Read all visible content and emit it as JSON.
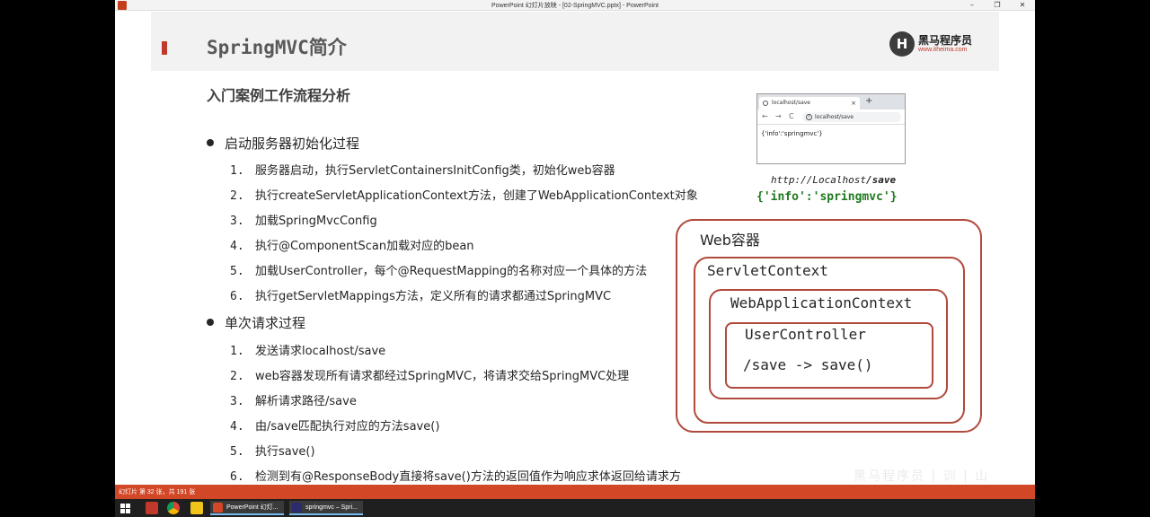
{
  "window": {
    "title": "PowerPoint 幻灯片放映 - [02-SpringMVC.pptx] - PowerPoint",
    "controls": {
      "minimize": "–",
      "restore": "❐",
      "close": "✕"
    }
  },
  "slide": {
    "title": "SpringMVC简介",
    "logo": {
      "mark": "H",
      "name": "黑马程序员",
      "url": "www.itheima.com"
    },
    "subtitle": "入门案例工作流程分析",
    "sections": [
      {
        "heading": "启动服务器初始化过程",
        "steps": [
          {
            "num": "1.",
            "text": "服务器启动，执行ServletContainersInitConfig类，初始化web容器"
          },
          {
            "num": "2.",
            "text": "执行createServletApplicationContext方法，创建了WebApplicationContext对象"
          },
          {
            "num": "3.",
            "text": "加载SpringMvcConfig"
          },
          {
            "num": "4.",
            "text": "执行@ComponentScan加载对应的bean"
          },
          {
            "num": "5.",
            "text": "加载UserController，每个@RequestMapping的名称对应一个具体的方法"
          },
          {
            "num": "6.",
            "text": "执行getServletMappings方法，定义所有的请求都通过SpringMVC"
          }
        ]
      },
      {
        "heading": "单次请求过程",
        "steps": [
          {
            "num": "1.",
            "text": "发送请求localhost/save"
          },
          {
            "num": "2.",
            "text": "web容器发现所有请求都经过SpringMVC，将请求交给SpringMVC处理"
          },
          {
            "num": "3.",
            "text": "解析请求路径/save"
          },
          {
            "num": "4.",
            "text": "由/save匹配执行对应的方法save()"
          },
          {
            "num": "5.",
            "text": "执行save()"
          },
          {
            "num": "6.",
            "text": "检测到有@ResponseBody直接将save()方法的返回值作为响应求体返回给请求方"
          }
        ]
      }
    ],
    "browser": {
      "tab_title": "localhost/save",
      "tab_close": "×",
      "new_tab": "+",
      "back": "←",
      "forward": "→",
      "reload": "C",
      "address": "localhost/save",
      "body": "{'info':'springmvc'}"
    },
    "url_caption": {
      "prefix": "http://",
      "host": "Localhost",
      "path": "/save"
    },
    "json_caption": "{'info':'springmvc'}",
    "containers": {
      "web": "Web容器",
      "servlet": "ServletContext",
      "webapp": "WebApplicationContext",
      "controller": "UserController",
      "mapping": "/save -> save()"
    }
  },
  "statusbar": {
    "text": "幻灯片 第 32 张，共 191 张"
  },
  "watermark": "黑马程序员 | 训 | 山",
  "taskbar": {
    "apps": [
      {
        "label": "PowerPoint 幻灯...",
        "color": "#d24726"
      },
      {
        "label": "springmvc – Spri...",
        "color": "#2b2b6e"
      }
    ]
  }
}
